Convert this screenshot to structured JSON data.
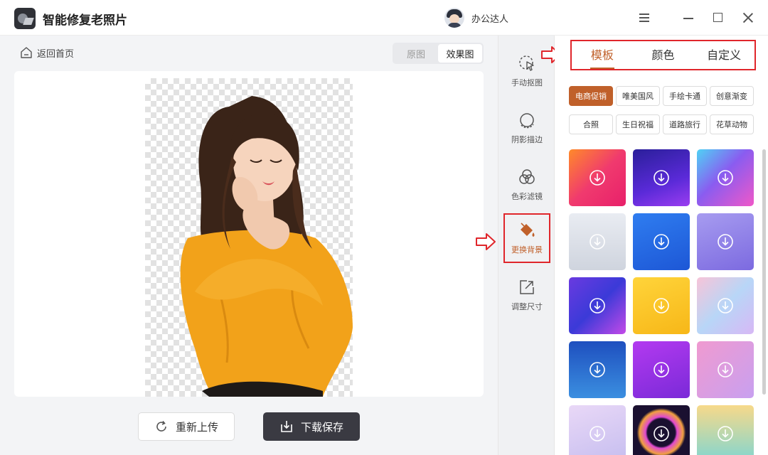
{
  "app": {
    "title": "智能修复老照片",
    "user_name": "办公达人"
  },
  "nav": {
    "back_label": "返回首页"
  },
  "view_toggle": {
    "original_label": "原图",
    "result_label": "效果图",
    "active": "效果图"
  },
  "actions": {
    "reupload_label": "重新上传",
    "download_label": "下载保存"
  },
  "tools": [
    {
      "label": "手动抠图",
      "icon": "cursor-select-icon"
    },
    {
      "label": "阴影描边",
      "icon": "shadow-outline-icon"
    },
    {
      "label": "色彩滤镜",
      "icon": "color-filter-icon"
    },
    {
      "label": "更换背景",
      "icon": "paint-bucket-icon",
      "active": true
    },
    {
      "label": "调整尺寸",
      "icon": "resize-icon"
    }
  ],
  "tabs": [
    {
      "label": "模板",
      "active": true
    },
    {
      "label": "颜色"
    },
    {
      "label": "自定义"
    }
  ],
  "categories": [
    {
      "label": "电商促销",
      "active": true
    },
    {
      "label": "唯美国风"
    },
    {
      "label": "手绘卡通"
    },
    {
      "label": "创意渐变"
    },
    {
      "label": "合照"
    },
    {
      "label": "生日祝福"
    },
    {
      "label": "道路旅行"
    },
    {
      "label": "花草动物"
    }
  ],
  "colors": {
    "accent": "#c0602a",
    "highlight": "#e0262b",
    "dark_button": "#3a3a42"
  }
}
